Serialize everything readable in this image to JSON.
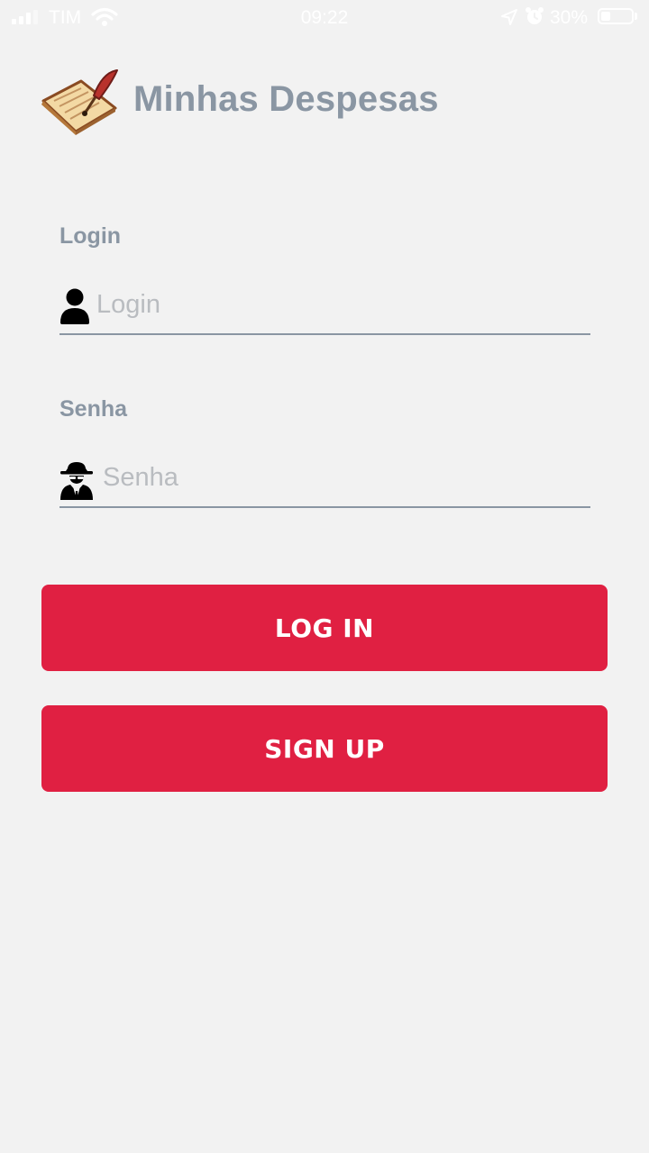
{
  "status_bar": {
    "carrier": "TIM",
    "time": "09:22",
    "battery_percent": "30%",
    "battery_level": 0.3,
    "icons": [
      "signal-icon",
      "wifi-icon",
      "location-arrow-icon",
      "alarm-icon",
      "battery-icon"
    ]
  },
  "header": {
    "title": "Minhas Despesas",
    "logo": "notepad-quill-icon"
  },
  "form": {
    "login": {
      "label": "Login",
      "placeholder": "Login",
      "value": "",
      "icon": "user-icon"
    },
    "password": {
      "label": "Senha",
      "placeholder": "Senha",
      "value": "",
      "icon": "spy-icon"
    }
  },
  "buttons": {
    "login_label": "LOG IN",
    "signup_label": "SIGN UP"
  },
  "colors": {
    "background": "#f2f2f2",
    "accent": "#e02042",
    "label_gray": "#8a96a3",
    "placeholder_gray": "#b9bcc0"
  }
}
